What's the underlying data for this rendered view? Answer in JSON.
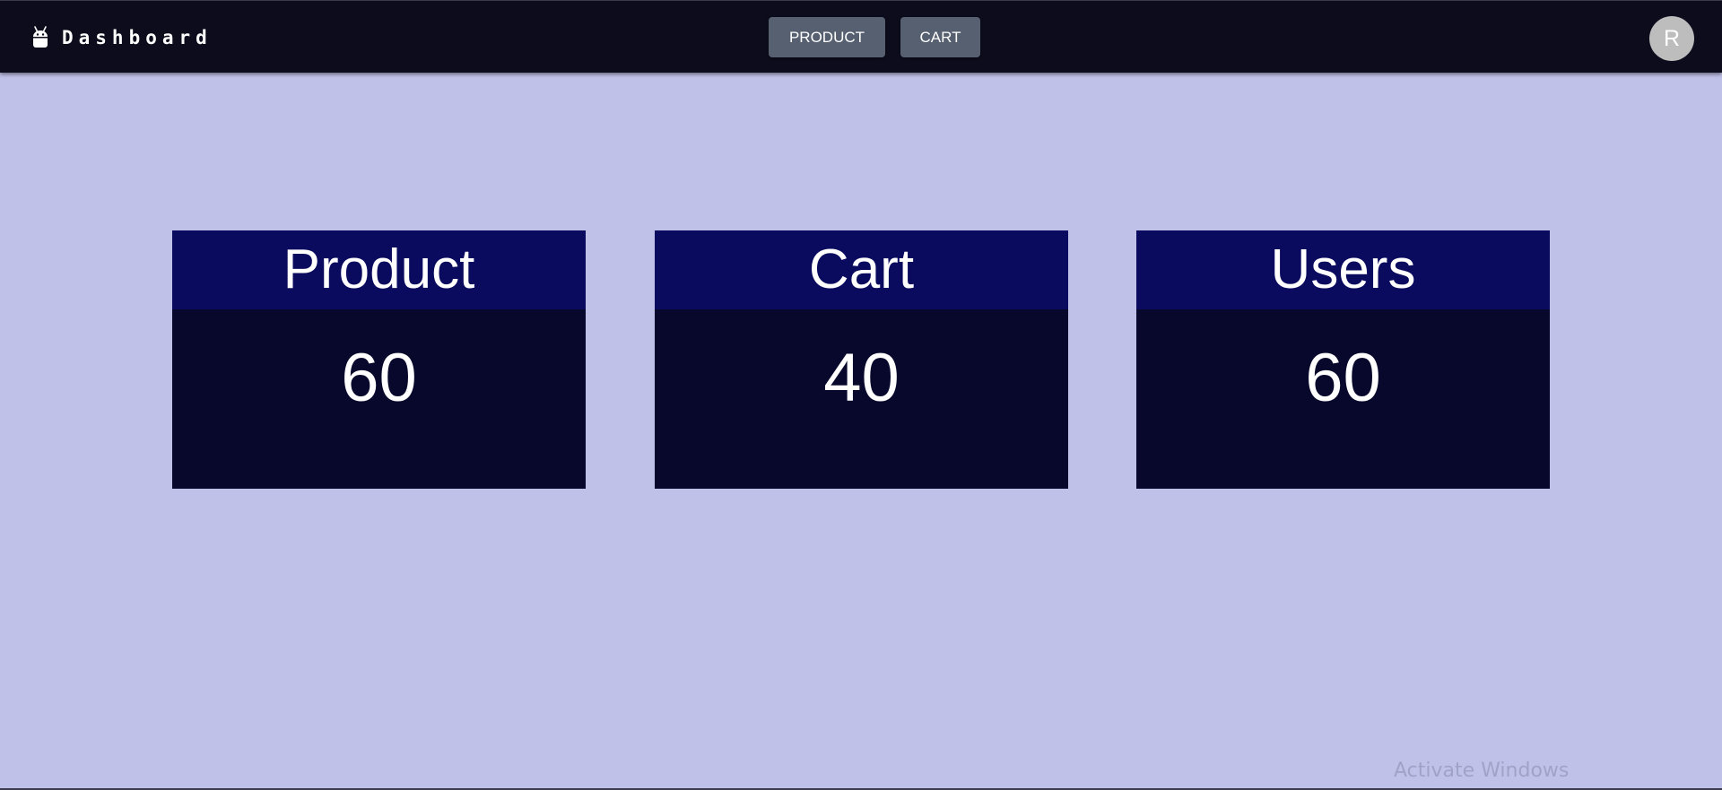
{
  "header": {
    "brand": "Dashboard",
    "brand_icon": "android-icon",
    "nav": [
      {
        "label": "PRODUCT"
      },
      {
        "label": "CART"
      }
    ],
    "avatar_initial": "R"
  },
  "cards": [
    {
      "title": "Product",
      "value": "60"
    },
    {
      "title": "Cart",
      "value": "40"
    },
    {
      "title": "Users",
      "value": "60"
    }
  ],
  "overlay": {
    "watermark": "Activate Windows"
  },
  "colors": {
    "page_bg": "#c0c1e8",
    "topbar_bg": "#0c0c1c",
    "card_header_bg": "#0a0a5e",
    "card_body_bg": "#08082c",
    "nav_button_bg": "#566070",
    "avatar_bg": "#bdbdbd"
  }
}
